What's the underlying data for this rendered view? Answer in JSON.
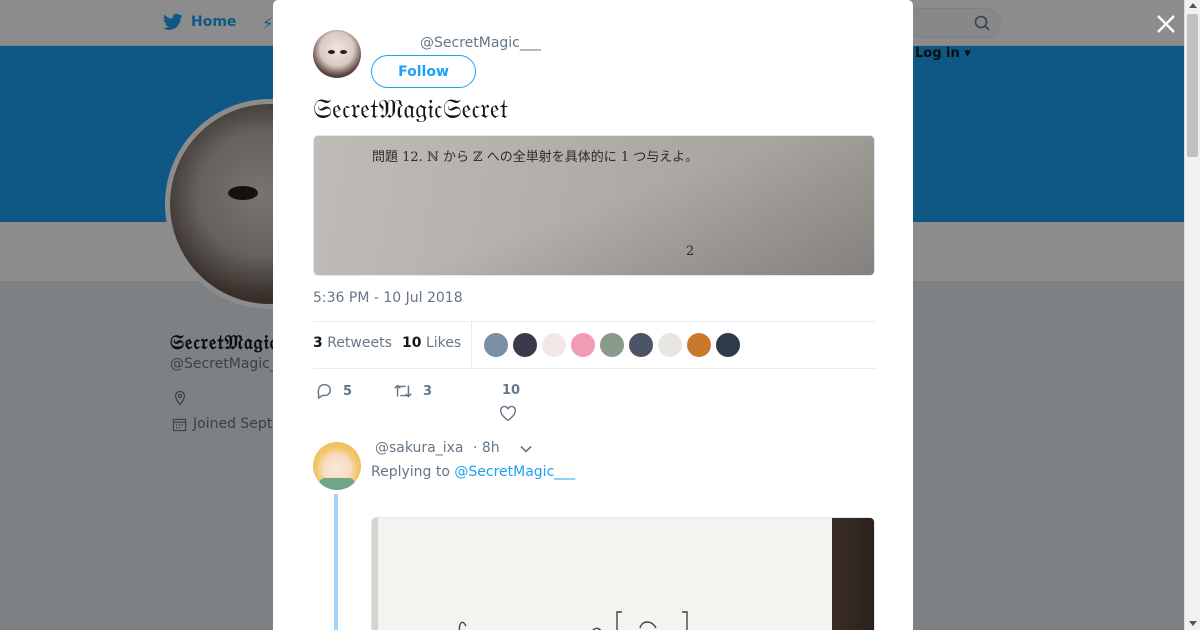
{
  "background": {
    "nav": {
      "home_label": "Home",
      "login_label": "Log in ▾"
    },
    "profile": {
      "name": "𝔖𝔢𝔠𝔯𝔢𝔱𝔐𝔞𝔤𝔦𝔠",
      "handle": "@SecretMagic_",
      "joined": "Joined Septe"
    }
  },
  "modal": {
    "close_icon": "close-icon",
    "tweet": {
      "handle": "@SecretMagic___",
      "follow_label": "Follow",
      "text": "𝔖𝔢𝔠𝔯𝔢𝔱𝔐𝔞𝔤𝔦𝔠𝔖𝔢𝔠𝔯𝔢𝔱",
      "photo_problem_text": "問題 12. ℕ から ℤ への全単射を具体的に 1 つ与えよ。",
      "photo_page_number": "2",
      "timestamp": "5:36 PM - 10 Jul 2018",
      "retweets_count": "3",
      "retweets_label": "Retweets",
      "likes_count": "10",
      "likes_label": "Likes",
      "likers": [
        {
          "color": "#7a8ea6"
        },
        {
          "color": "#3a3a4a"
        },
        {
          "color": "#f2e8e8"
        },
        {
          "color": "#f29bb5"
        },
        {
          "color": "#8a9a8a"
        },
        {
          "color": "#4c5566"
        },
        {
          "color": "#e8e6e2"
        },
        {
          "color": "#c9782c"
        },
        {
          "color": "#2f3a48"
        }
      ],
      "reply_count": "5",
      "retweet_count": "3",
      "like_count": "10"
    },
    "reply": {
      "handle": "@sakura_ixa",
      "time": "· 8h",
      "replying_to_label": "Replying to",
      "replying_to_handle": "@SecretMagic___"
    }
  },
  "colors": {
    "accent": "#1da1f2",
    "muted": "#657786",
    "thread_line": "#a3d4f7"
  }
}
